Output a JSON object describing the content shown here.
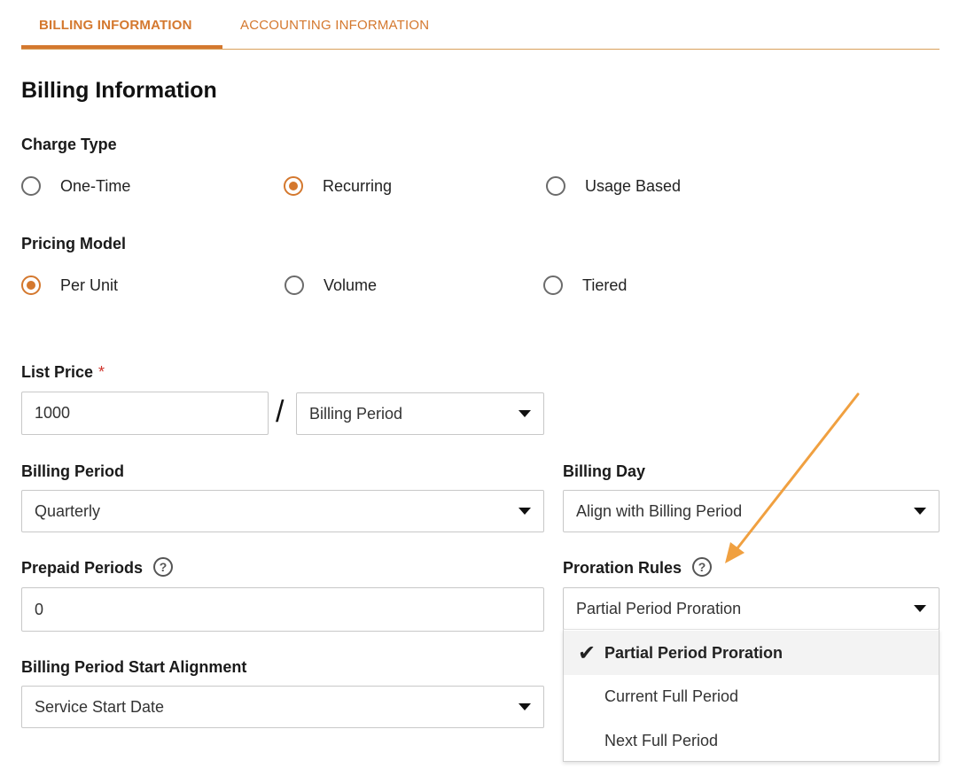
{
  "tabs": [
    {
      "label": "BILLING INFORMATION",
      "active": true
    },
    {
      "label": "ACCOUNTING INFORMATION",
      "active": false
    }
  ],
  "heading": "Billing Information",
  "charge_type": {
    "label": "Charge Type",
    "options": [
      {
        "label": "One-Time",
        "selected": false
      },
      {
        "label": "Recurring",
        "selected": true
      },
      {
        "label": "Usage Based",
        "selected": false
      }
    ]
  },
  "pricing_model": {
    "label": "Pricing Model",
    "options": [
      {
        "label": "Per Unit",
        "selected": true
      },
      {
        "label": "Volume",
        "selected": false
      },
      {
        "label": "Tiered",
        "selected": false
      }
    ]
  },
  "list_price": {
    "label": "List Price",
    "required_mark": "*",
    "value": "1000",
    "separator": "/",
    "per_value": "Billing Period"
  },
  "billing_period": {
    "label": "Billing Period",
    "value": "Quarterly"
  },
  "billing_day": {
    "label": "Billing Day",
    "value": "Align with Billing Period"
  },
  "prepaid_periods": {
    "label": "Prepaid Periods",
    "help": "?",
    "value": "0"
  },
  "proration_rules": {
    "label": "Proration Rules",
    "help": "?",
    "value": "Partial Period Proration",
    "options": [
      {
        "label": "Partial Period Proration",
        "selected": true,
        "check": "✔"
      },
      {
        "label": "Current Full Period",
        "selected": false
      },
      {
        "label": "Next Full Period",
        "selected": false
      }
    ]
  },
  "start_alignment": {
    "label": "Billing Period Start Alignment",
    "value": "Service Start Date"
  },
  "colors": {
    "accent": "#d4782e",
    "annotation_arrow": "#f0a040",
    "required": "#d0342c"
  },
  "icons": {
    "help": "question-circle-icon",
    "caret": "caret-down-icon",
    "check": "checkmark-icon"
  }
}
